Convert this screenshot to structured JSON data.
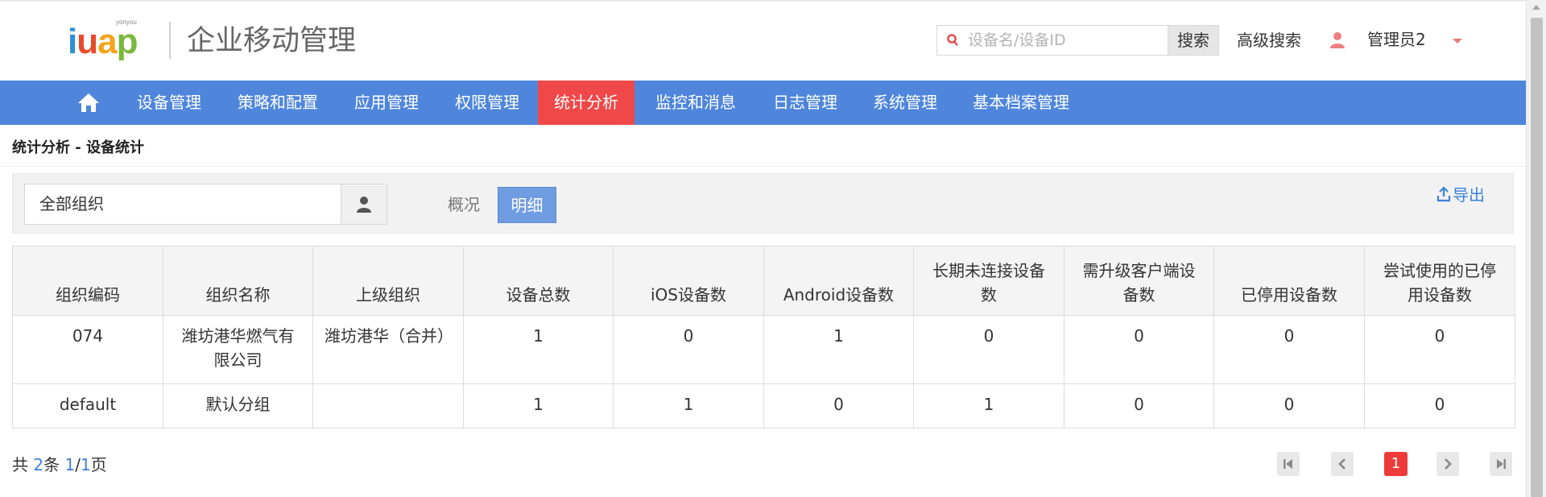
{
  "header": {
    "logo_small": "yonyou",
    "logo_letters": [
      "i",
      "u",
      "a",
      "p"
    ],
    "app_title": "企业移动管理",
    "search_placeholder": "设备名/设备ID",
    "search_button": "搜索",
    "advanced_search": "高级搜索",
    "user_name": "管理员2",
    "icons": {
      "search": "search-icon",
      "user": "user-icon",
      "caret": "caret-down-icon"
    }
  },
  "nav": {
    "home_icon": "home-icon",
    "items": [
      {
        "label": "设备管理",
        "active": false
      },
      {
        "label": "策略和配置",
        "active": false
      },
      {
        "label": "应用管理",
        "active": false
      },
      {
        "label": "权限管理",
        "active": false
      },
      {
        "label": "统计分析",
        "active": true
      },
      {
        "label": "监控和消息",
        "active": false
      },
      {
        "label": "日志管理",
        "active": false
      },
      {
        "label": "系统管理",
        "active": false
      },
      {
        "label": "基本档案管理",
        "active": false
      }
    ]
  },
  "breadcrumb": "统计分析 -  设备统计",
  "toolbar": {
    "org_value": "全部组织",
    "tabs": [
      {
        "label": "概况",
        "active": false
      },
      {
        "label": "明细",
        "active": true
      }
    ],
    "export_label": "导出"
  },
  "table": {
    "columns": [
      "组织编码",
      "组织名称",
      "上级组织",
      "设备总数",
      "iOS设备数",
      "Android设备数",
      "长期未连接设备数",
      "需升级客户端设备数",
      "已停用设备数",
      "尝试使用的已停用设备数"
    ],
    "rows": [
      [
        "074",
        "潍坊港华燃气有限公司",
        "潍坊港华（合并）",
        "1",
        "0",
        "1",
        "0",
        "0",
        "0",
        "0"
      ],
      [
        "default",
        "默认分组",
        "",
        "1",
        "1",
        "0",
        "1",
        "0",
        "0",
        "0"
      ]
    ]
  },
  "pagination": {
    "prefix": "共",
    "total": "2",
    "unit": "条",
    "current": "1",
    "separator": "/",
    "pages": "1",
    "suffix": "页",
    "current_page_button": "1"
  },
  "colors": {
    "nav_bg": "#4f86dc",
    "nav_active": "#f04848",
    "accent_blue": "#3d82d8",
    "pager_active": "#ef3a3a"
  }
}
